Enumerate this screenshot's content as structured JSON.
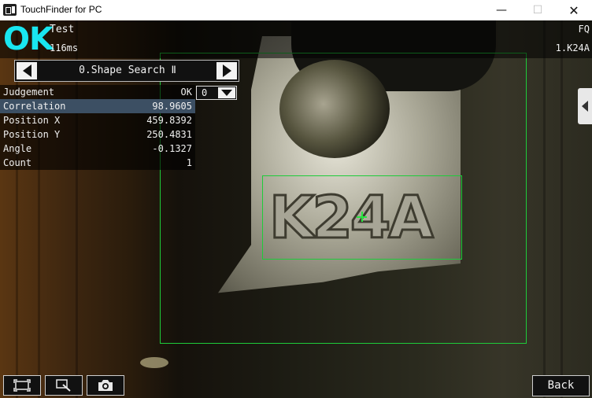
{
  "window": {
    "title": "TouchFinder for PC",
    "minimize_symbol": "—",
    "maximize_symbol": "☐",
    "close_symbol": "✕"
  },
  "header": {
    "overall_judgement": "OK",
    "scene_name": "Test",
    "processing_time": "116ms",
    "mode_label": "FQ",
    "scene_id": "1.K24A"
  },
  "item_selector": {
    "current_item": "0.Shape Search Ⅱ"
  },
  "results": {
    "judgement_label": "Judgement",
    "judgement_value": "OK",
    "judgement_dropdown_value": "0",
    "rows": [
      {
        "label": "Correlation",
        "value": "98.9605",
        "selected": true
      },
      {
        "label": "Position X",
        "value": "459.8392"
      },
      {
        "label": "Position Y",
        "value": "250.4831"
      },
      {
        "label": "Angle",
        "value": "-0.1327"
      },
      {
        "label": "Count",
        "value": "1"
      }
    ]
  },
  "image": {
    "part_marking": "K24A"
  },
  "footer": {
    "back_label": "Back"
  },
  "icons": {
    "app": "touchfinder-app-icon",
    "fit": "fit-screen-icon",
    "zoom": "zoom-icon",
    "capture": "camera-icon"
  },
  "colors": {
    "ok": "#19e6f0",
    "region": "#1ecc3a",
    "selected_row": "#3c4f63"
  }
}
